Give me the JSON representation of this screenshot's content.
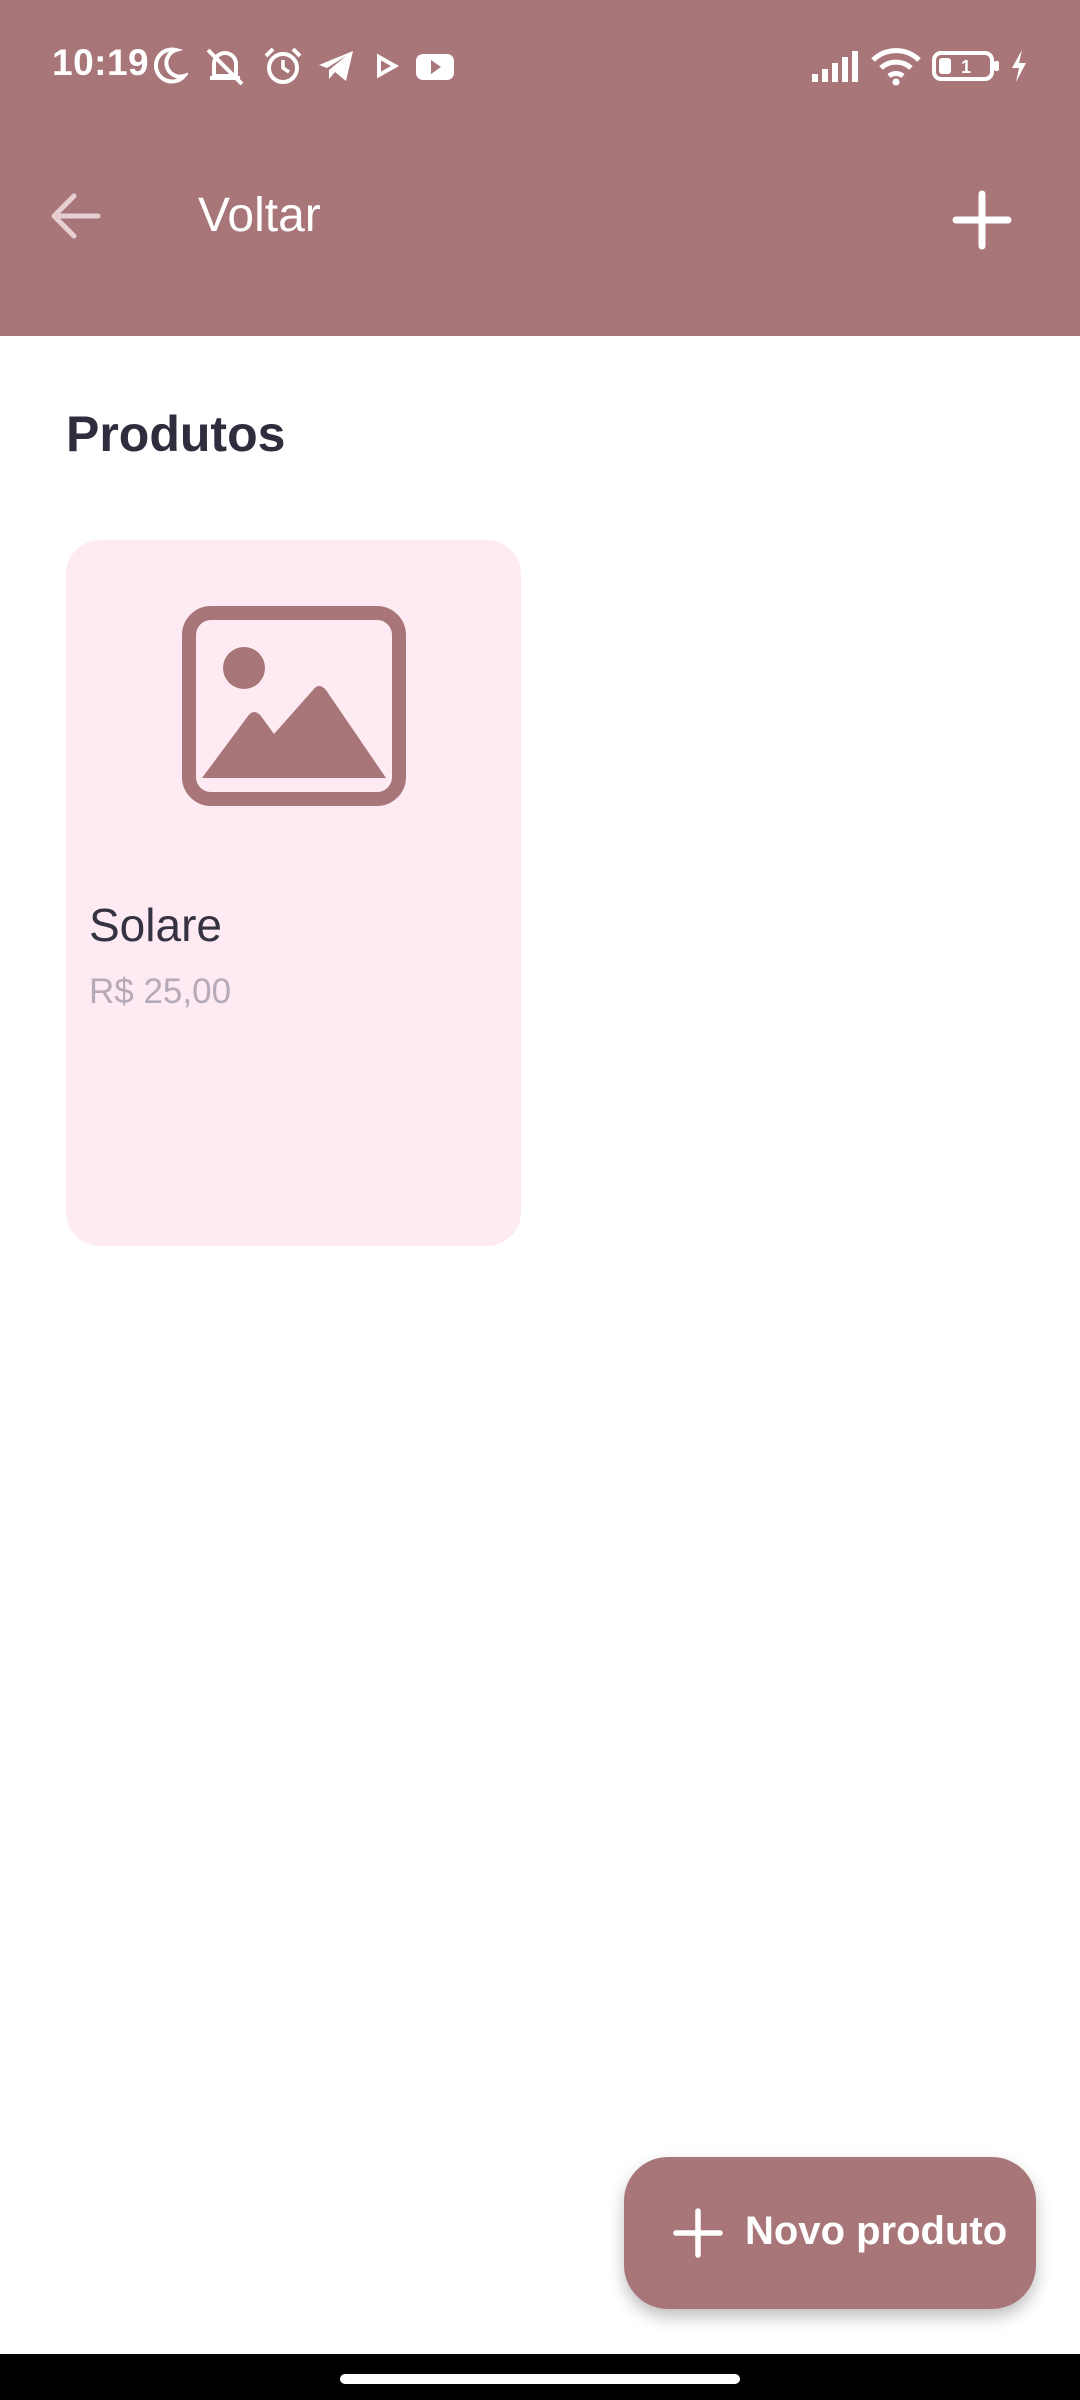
{
  "status_bar": {
    "time": "10:19",
    "icons": [
      "moon-icon",
      "mute-icon",
      "alarm-icon",
      "telegram-icon",
      "play-icon",
      "youtube-icon",
      "signal-icon",
      "wifi-icon",
      "battery-icon",
      "charging-icon"
    ],
    "battery_level": "1"
  },
  "toolbar": {
    "back_label": "Voltar",
    "back_icon": "arrow-left-icon",
    "add_icon": "plus-icon"
  },
  "section": {
    "title": "Produtos"
  },
  "products": [
    {
      "name": "Solare",
      "price": "R$ 25,00",
      "image_icon": "image-placeholder-icon"
    }
  ],
  "fab": {
    "label": "Novo produto",
    "icon": "plus-icon"
  },
  "colors": {
    "primary": "#a87679",
    "card_background": "#fdeaf3",
    "title_text": "#2f2d3d",
    "price_text": "#b6aab8"
  }
}
